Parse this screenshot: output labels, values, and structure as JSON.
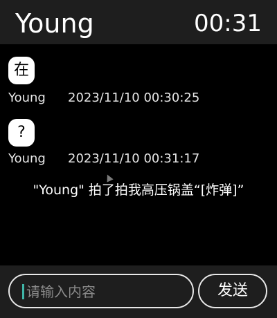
{
  "header": {
    "title": "Young",
    "time": "00:31"
  },
  "messages": [
    {
      "text": "在",
      "sender": "Young",
      "timestamp": "2023/11/10 00:30:25"
    },
    {
      "text": "?",
      "sender": "Young",
      "timestamp": "2023/11/10 00:31:17"
    }
  ],
  "system_message": "\"Young\" 拍了拍我高压锅盖“[炸弹]”",
  "composer": {
    "placeholder": "请输入内容",
    "send_label": "发送"
  },
  "colors": {
    "background": "#000000",
    "bar": "#1e1e1e",
    "bubble": "#ffffff",
    "caret": "#3fb6a8"
  },
  "icons": {
    "cursor": "mouse-pointer-icon"
  }
}
